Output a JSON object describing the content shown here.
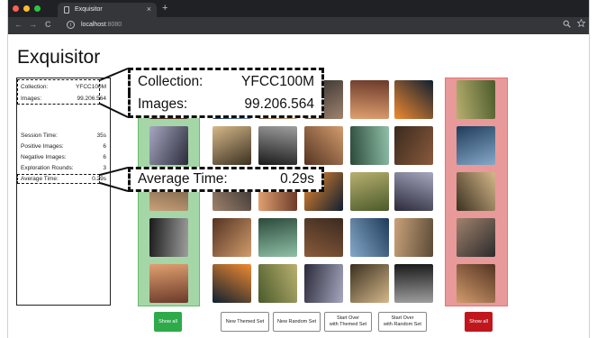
{
  "browser": {
    "tab_title": "Exquisitor",
    "tab_close": "×",
    "new_tab": "+",
    "back": "←",
    "forward": "→",
    "reload": "C",
    "info": "i",
    "url_host": "localhost",
    "url_port": ":8080",
    "zoom_icon": "search-icon",
    "bookmark_icon": "star-icon",
    "dots": [
      "#ff5f57",
      "#febc2e",
      "#28c840"
    ]
  },
  "app": {
    "title": "Exquisitor"
  },
  "stats": {
    "collection_label": "Collection:",
    "collection_value": "YFCC100M",
    "images_label": "Images:",
    "images_value": "99.206.564",
    "session_time_label": "Session Time:",
    "session_time_value": "35s",
    "positive_label": "Positive Images:",
    "positive_value": "6",
    "negative_label": "Negative Images:",
    "negative_value": "6",
    "rounds_label": "Exploration Rounds:",
    "rounds_value": "3",
    "avg_time_label": "Average Time:",
    "avg_time_value": "0.29s"
  },
  "callouts": {
    "collection_label": "Collection:",
    "collection_value": "YFCC100M",
    "images_label": "Images:",
    "images_value": "99.206.564",
    "avg_time_label": "Average Time:",
    "avg_time_value": "0.29s"
  },
  "buttons": {
    "show_all_positive": "Show all",
    "new_themed_set": "New Themed Set",
    "new_random_set": "New Random Set",
    "start_over_themed_1": "Start Over",
    "start_over_themed_2": "with Themed Set",
    "start_over_random_1": "Start Over",
    "start_over_random_2": "with Random Set",
    "show_all_negative": "Show all"
  },
  "colors": {
    "positive_column": "#a5d6a7",
    "negative_column": "#e8999a",
    "show_all_positive": "#2eaa4b",
    "show_all_negative": "#c0171e"
  }
}
